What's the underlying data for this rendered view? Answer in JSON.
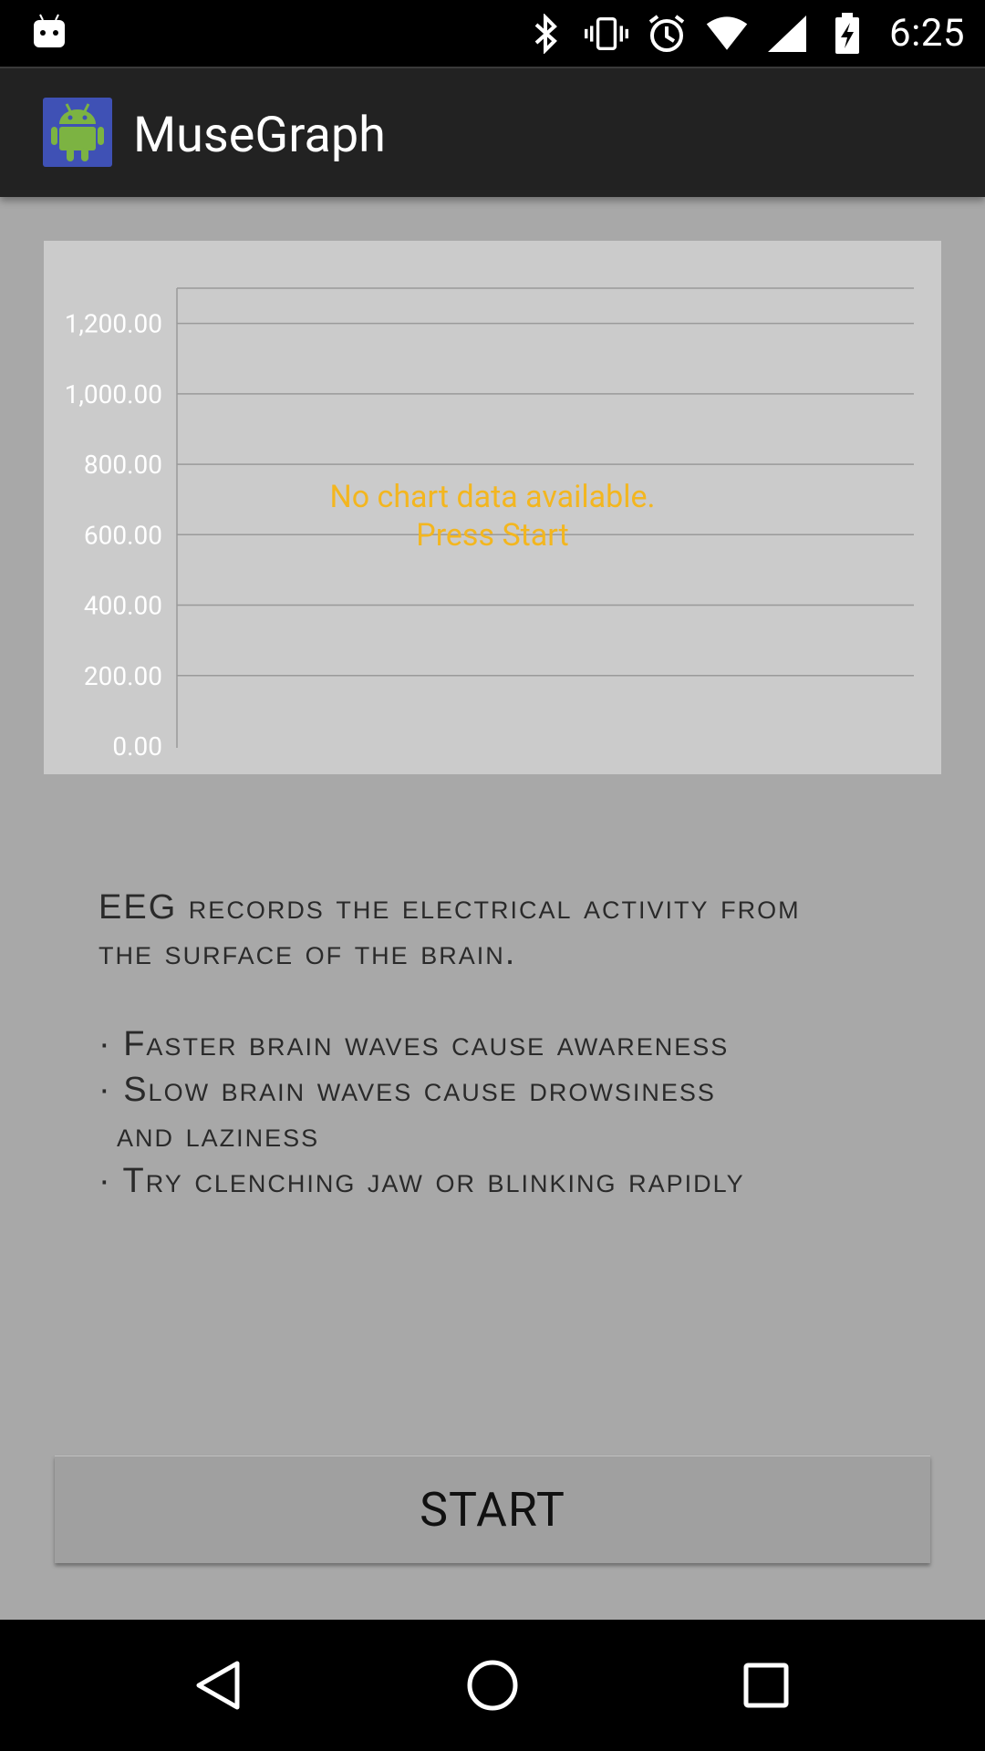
{
  "status_bar": {
    "time": "6:25",
    "icons": [
      "android-notification-icon",
      "bluetooth-icon",
      "vibrate-icon",
      "alarm-icon",
      "wifi-icon",
      "cell-signal-icon",
      "battery-charging-icon"
    ]
  },
  "app_bar": {
    "title": "MuseGraph",
    "icon": "android-robot-icon",
    "icon_bg": "#3f51b5",
    "icon_fg": "#7cb342"
  },
  "chart_data": {
    "type": "line",
    "series": [],
    "y_ticks": [
      "0.00",
      "200.00",
      "400.00",
      "600.00",
      "800.00",
      "1,000.00",
      "1,200.00"
    ],
    "ylim": [
      0,
      1300
    ],
    "grid": true,
    "empty_message_line1": "No chart data available.",
    "empty_message_line2": "Press Start"
  },
  "description": {
    "line1": "EEG records the electrical activity from",
    "line2": "the surface of the brain.",
    "bullet1": "· Faster brain waves cause awareness",
    "bullet2a": "· Slow brain waves cause drowsiness",
    "bullet2b": "and laziness",
    "bullet3": "· Try clenching jaw or blinking rapidly"
  },
  "start_button": {
    "label": "START"
  },
  "nav_bar": {
    "icons": [
      "back-icon",
      "home-icon",
      "recents-icon"
    ]
  }
}
